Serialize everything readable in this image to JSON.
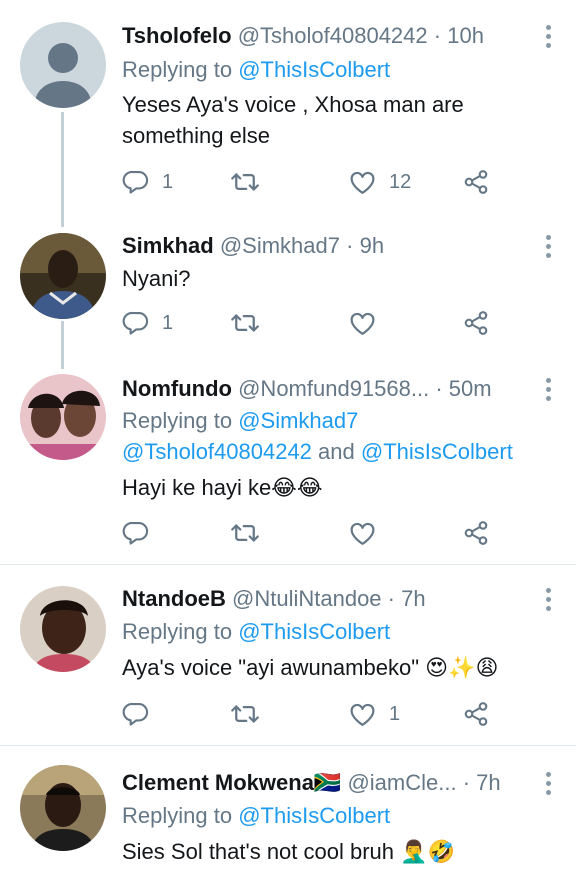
{
  "tweets": [
    {
      "name": "Tsholofelo",
      "handle": "@Tsholof40804242",
      "separator": "·",
      "time": "10h",
      "replying_prefix": "Replying to",
      "replying_to": "@ThisIsColbert",
      "text": "Yeses Aya's voice , Xhosa man are something else",
      "reply_count": "1",
      "retweet_count": "",
      "like_count": "12",
      "avatar": "default-avatar"
    },
    {
      "name": "Simkhad",
      "handle": "@Simkhad7",
      "separator": "·",
      "time": "9h",
      "text": "Nyani?",
      "reply_count": "1",
      "retweet_count": "",
      "like_count": "",
      "avatar": "photo-avatar"
    },
    {
      "name": "Nomfundo",
      "handle": "@Nomfund91568...",
      "separator": "·",
      "time": "50m",
      "replying_prefix": "Replying to",
      "replying_to": "@Simkhad7",
      "replying_to_2": "@Tsholof40804242",
      "replying_and": "and",
      "replying_to_3": "@ThisIsColbert",
      "text": "Hayi ke hayi ke😂😂",
      "reply_count": "",
      "retweet_count": "",
      "like_count": "",
      "avatar": "photo-avatar"
    },
    {
      "name": "NtandoeB",
      "handle": "@NtuliNtandoe",
      "separator": "·",
      "time": "7h",
      "replying_prefix": "Replying to",
      "replying_to": "@ThisIsColbert",
      "text": "Aya's voice \"ayi awunambeko\" 😍✨😩",
      "reply_count": "",
      "retweet_count": "",
      "like_count": "1",
      "avatar": "photo-avatar"
    },
    {
      "name": "Clement Mokwena🇿🇦",
      "handle": "@iamCle...",
      "separator": "·",
      "time": "7h",
      "replying_prefix": "Replying to",
      "replying_to": "@ThisIsColbert",
      "text": "Sies Sol that's not cool bruh 🤦‍♂️🤣",
      "avatar": "photo-avatar"
    }
  ],
  "colors": {
    "link": "#1d9bf0",
    "secondary_text": "#657786",
    "thread_line": "#c4cfd6",
    "divider": "#e1e8ed"
  },
  "icons": [
    "reply-icon",
    "retweet-icon",
    "like-icon",
    "share-icon",
    "more-icon"
  ]
}
